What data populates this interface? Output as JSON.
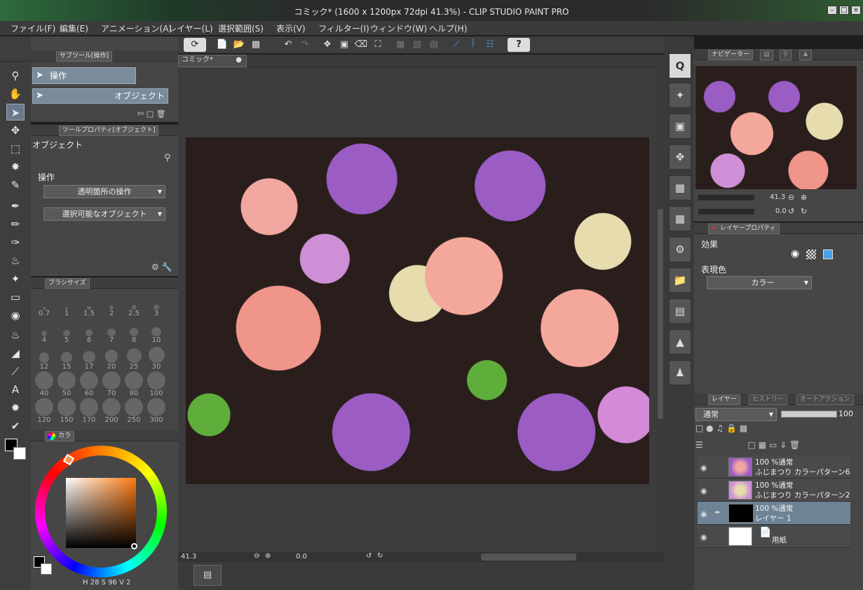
{
  "window": {
    "title": "コミック* (1600 x 1200px 72dpi 41.3%)  - CLIP STUDIO PAINT PRO"
  },
  "menu": [
    "ファイル(F)",
    "編集(E)",
    "アニメーション(A)",
    "レイヤー(L)",
    "選択範囲(S)",
    "表示(V)",
    "フィルター(I)",
    "ウィンドウ(W)",
    "ヘルプ(H)"
  ],
  "subtool": {
    "tab_label": "サブツール[操作]",
    "group_label": "操作",
    "item_label": "オブジェクト"
  },
  "tool_property": {
    "tab_label": "ツールプロパティ[オブジェクト]",
    "title": "オブジェクト",
    "section_label": "操作",
    "dropdown1": "透明箇所の操作",
    "dropdown2": "選択可能なオブジェクト"
  },
  "brush_size": {
    "tab_label": "ブラシサイズ",
    "sizes": [
      "0.7",
      "1",
      "1.5",
      "2",
      "2.5",
      "3",
      "4",
      "5",
      "6",
      "7",
      "8",
      "10",
      "12",
      "15",
      "17",
      "20",
      "25",
      "30",
      "40",
      "50",
      "60",
      "70",
      "80",
      "100",
      "120",
      "150",
      "170",
      "200",
      "250",
      "300"
    ]
  },
  "color": {
    "tab_label": "カラ",
    "h_label": "H",
    "h_value": "28",
    "s_label": "S",
    "s_value": "96",
    "v_label": "V",
    "v_value": "2",
    "main_color": "#000000",
    "sub_color": "#ffffff"
  },
  "canvas": {
    "tab_label": "コミック*",
    "zoom": "41.3",
    "rotation": "0.0"
  },
  "navigator": {
    "tab_label": "ナビゲーター",
    "zoom": "41.3",
    "rotation": "0.0"
  },
  "layer_property": {
    "tab_label": "レイヤープロパティ",
    "effect_label": "効果",
    "expression_label": "表現色",
    "expression_value": "カラー"
  },
  "layers_panel": {
    "tab_label": "レイヤー",
    "tab_history": "ヒストリー",
    "tab_auto": "オートアクション",
    "blend_mode": "通常",
    "opacity": "100",
    "layers": [
      {
        "line1": "100 %通常",
        "line2": "ふじまつり カラーパターン6",
        "selected": false
      },
      {
        "line1": "100 %通常",
        "line2": "ふじまつり カラーパターン2",
        "selected": false
      },
      {
        "line1": "100 %通常",
        "line2": "レイヤー 1",
        "selected": true
      },
      {
        "line1": "",
        "line2": "用紙",
        "selected": false
      }
    ]
  },
  "colors": {
    "panel_bg": "#464646",
    "canvas_bg": "#3c3c3c",
    "selected_layer": "#6e8496",
    "accent_blue": "#4a90e0"
  }
}
